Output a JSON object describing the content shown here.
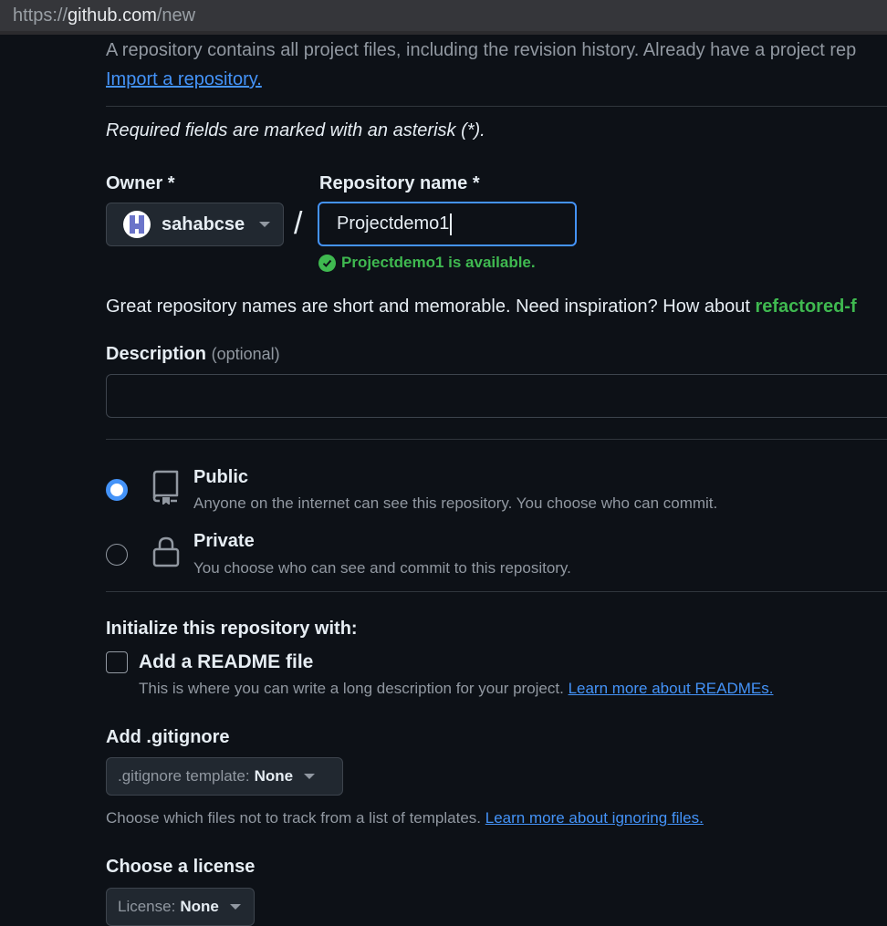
{
  "browser": {
    "url_protocol": "https://",
    "url_host": "github.com",
    "url_path": "/new"
  },
  "intro": {
    "text": "A repository contains all project files, including the revision history. Already have a project rep",
    "import_link": "Import a repository."
  },
  "form": {
    "required_note": "Required fields are marked with an asterisk (*).",
    "owner_label": "Owner *",
    "owner_value": "sahabcse",
    "separator": "/",
    "repo_label": "Repository name *",
    "repo_value": "Projectdemo1",
    "availability": "Projectdemo1 is available.",
    "name_hint": "Great repository names are short and memorable. Need inspiration? How about",
    "name_suggestion": "refactored-f",
    "description_label": "Description",
    "description_optional": "(optional)",
    "description_value": ""
  },
  "visibility": {
    "selected": "public",
    "options": [
      {
        "title": "Public",
        "description": "Anyone on the internet can see this repository. You choose who can commit."
      },
      {
        "title": "Private",
        "description": "You choose who can see and commit to this repository."
      }
    ]
  },
  "initialize": {
    "heading": "Initialize this repository with:",
    "readme_title": "Add a README file",
    "readme_checked": false,
    "readme_desc": "This is where you can write a long description for your project.",
    "readme_link": "Learn more about READMEs."
  },
  "gitignore": {
    "heading": "Add .gitignore",
    "select_label": ".gitignore template:",
    "select_value": "None",
    "help": "Choose which files not to track from a list of templates.",
    "help_link": "Learn more about ignoring files."
  },
  "license": {
    "heading": "Choose a license",
    "select_label": "License:",
    "select_value": "None"
  },
  "colors": {
    "background": "#0d1117",
    "accent_blue": "#4493f8",
    "success_green": "#3fb950",
    "muted_text": "#9198a1"
  }
}
